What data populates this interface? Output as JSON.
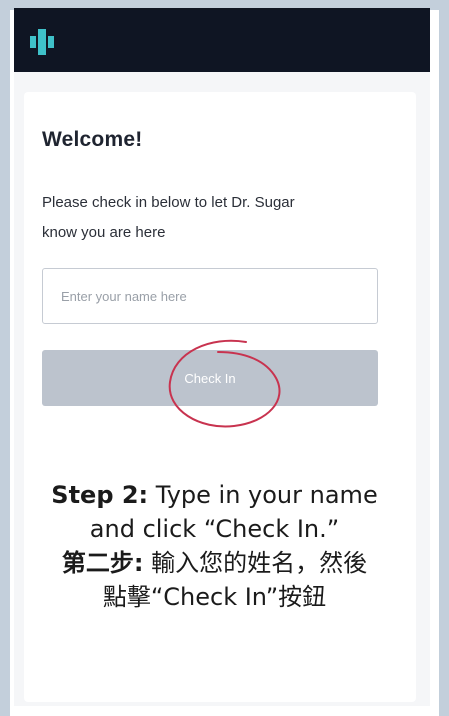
{
  "header": {
    "logo_icon": "medical-cross-logo-icon",
    "background": "#0f1523",
    "logo_color": "#3fc1c9"
  },
  "card": {
    "title": "Welcome!",
    "intro_line1": "Please check in below to let Dr. Sugar",
    "intro_line2": "know you are here"
  },
  "form": {
    "name_value": "",
    "name_placeholder": "Enter your name here",
    "checkin_label": "Check In"
  },
  "annotation": {
    "circle_color": "#c8334f"
  },
  "caption": {
    "step_en_bold": "Step 2:",
    "step_en_rest1": " Type in your name",
    "step_en_rest2": "and click “Check In.”",
    "step_zh_bold": "第二步:",
    "step_zh_rest1": " 輸入您的姓名，然後",
    "step_zh_rest2": "點擊“Check In”按鈕"
  },
  "colors": {
    "page_background": "#c3cfdb",
    "button_disabled": "#bcc3cd"
  }
}
